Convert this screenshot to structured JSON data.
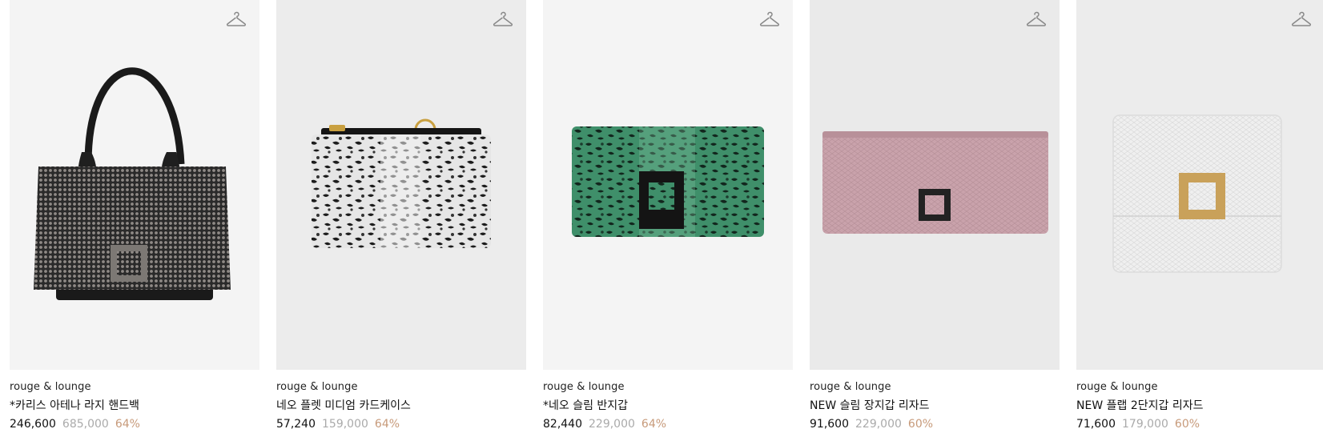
{
  "products": [
    {
      "brand": "rouge & lounge",
      "name": "*카리스 아테나 라지 핸드백",
      "sale_price": "246,600",
      "original_price": "685,000",
      "discount": "64%",
      "image_icon": "black-handbag-image"
    },
    {
      "brand": "rouge & lounge",
      "name": "네오 플렛 미디엄 카드케이스",
      "sale_price": "57,240",
      "original_price": "159,000",
      "discount": "64%",
      "image_icon": "python-card-case-image"
    },
    {
      "brand": "rouge & lounge",
      "name": "*네오 슬림 반지갑",
      "sale_price": "82,440",
      "original_price": "229,000",
      "discount": "64%",
      "image_icon": "green-python-wallet-image"
    },
    {
      "brand": "rouge & lounge",
      "name": "NEW 슬림 장지갑 리자드",
      "sale_price": "91,600",
      "original_price": "229,000",
      "discount": "60%",
      "image_icon": "pink-lizard-wallet-image"
    },
    {
      "brand": "rouge & lounge",
      "name": "NEW 플랩 2단지갑 리자드",
      "sale_price": "71,600",
      "original_price": "179,000",
      "discount": "60%",
      "image_icon": "white-lizard-wallet-image"
    }
  ],
  "colors": {
    "discount": "#c79a7a",
    "original_price": "#aaaaaa"
  },
  "icons": {
    "wishlist": "hanger-icon"
  }
}
